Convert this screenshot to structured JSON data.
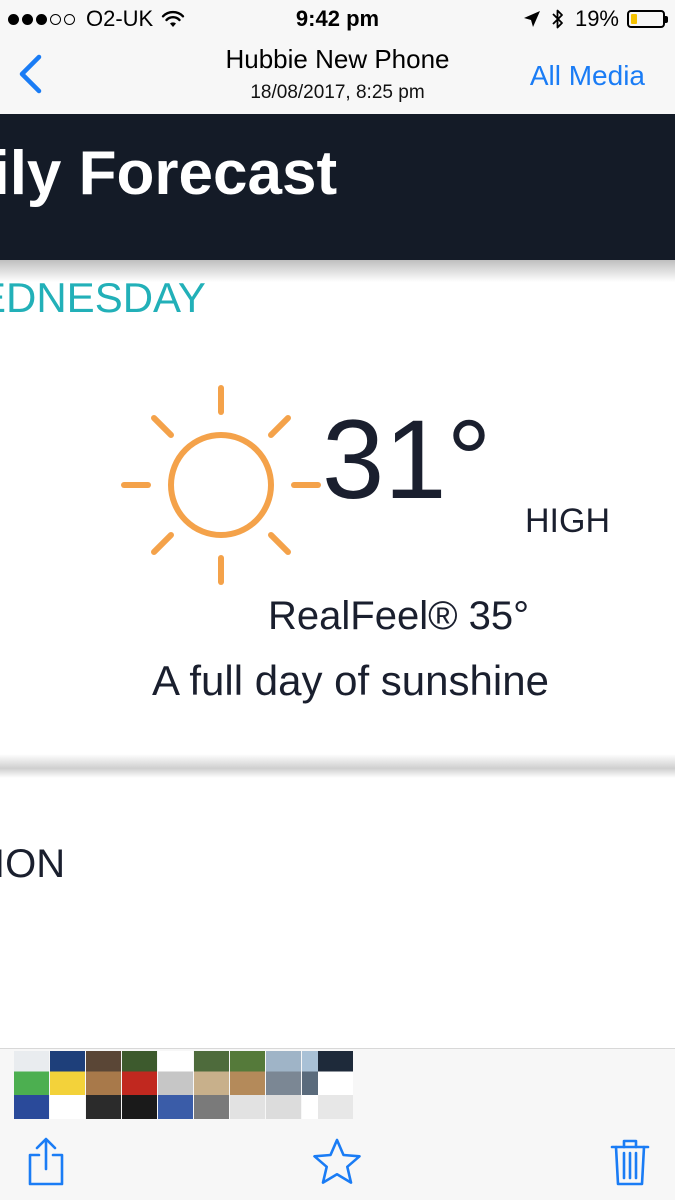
{
  "status_bar": {
    "carrier": "O2-UK",
    "signal_bars_filled": 3,
    "signal_bars_total": 5,
    "time": "9:42 pm",
    "battery_percent": "19%",
    "battery_level": 0.19,
    "battery_color": "#f5c200"
  },
  "nav": {
    "back_icon": "chevron-left-icon",
    "title": "Hubbie New Phone",
    "subtitle": "18/08/2017, 8:25 pm",
    "all_media_label": "All Media",
    "accent_color": "#1a7cf5"
  },
  "photo": {
    "header_title": "aily Forecast",
    "header_bg": "#141b27",
    "day_label": "EDNESDAY",
    "day_color": "#22b0b8",
    "icon": "sun-icon",
    "icon_color": "#f4a24a",
    "temperature": "31°",
    "temperature_label": "HIGH",
    "realfeel": "RealFeel® 35°",
    "phrase": "A full day of sunshine",
    "next_section_label": "ION"
  },
  "thumbnails": {
    "items": [
      {
        "name": "thumb-1",
        "colors": [
          "#e9ecef",
          "#4caf50",
          "#2a4a9a"
        ]
      },
      {
        "name": "thumb-2",
        "colors": [
          "#1e3f7a",
          "#f3d23a",
          "#ffffff"
        ]
      },
      {
        "name": "thumb-3",
        "colors": [
          "#5a4636",
          "#a8794a",
          "#2b2b2b"
        ]
      },
      {
        "name": "thumb-4",
        "colors": [
          "#3d5a2d",
          "#c1281f",
          "#1a1a1a"
        ]
      },
      {
        "name": "thumb-5",
        "colors": [
          "#ffffff",
          "#c6c6c6",
          "#3a5ca8"
        ]
      },
      {
        "name": "thumb-6",
        "colors": [
          "#4e6b3c",
          "#c8b08b",
          "#7a7a7a"
        ]
      },
      {
        "name": "thumb-7",
        "colors": [
          "#557a3a",
          "#b48a5a",
          "#e2e2e2"
        ]
      },
      {
        "name": "thumb-8",
        "colors": [
          "#9fb4c7",
          "#7b8794",
          "#dcdcdc"
        ]
      },
      {
        "name": "thumb-9",
        "colors": [
          "#a9c1d6",
          "#5a6b7c",
          "#ffffff"
        ]
      },
      {
        "name": "thumb-10-current",
        "colors": [
          "#1e2a3a",
          "#ffffff",
          "#e7e7e7"
        ]
      }
    ]
  },
  "toolbar": {
    "share_icon": "share-icon",
    "favorite_icon": "star-icon",
    "delete_icon": "trash-icon"
  }
}
